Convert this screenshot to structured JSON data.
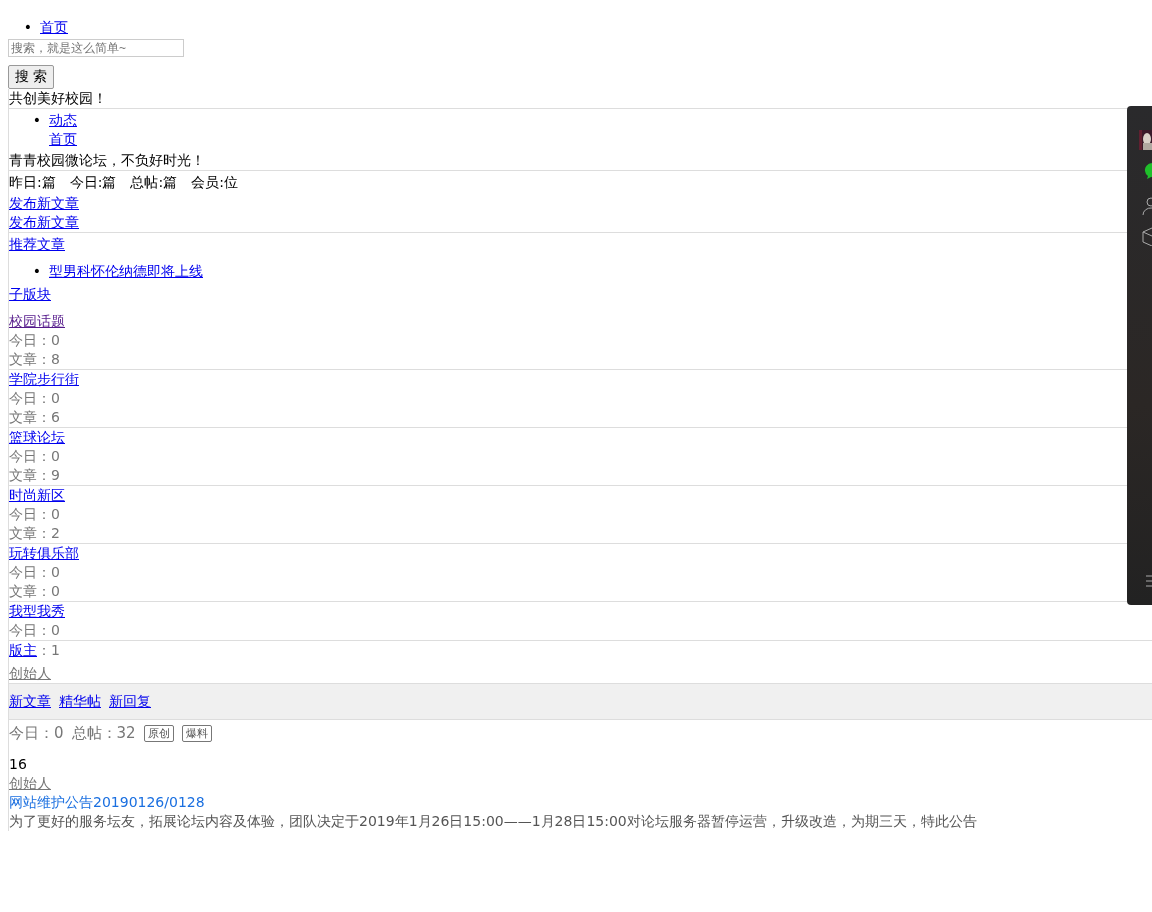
{
  "top_nav": [
    {
      "marker": "•",
      "label": "首页"
    }
  ],
  "search": {
    "placeholder": "搜索，就是这么简单~",
    "button": "搜 索"
  },
  "slogan": "共创美好校园！",
  "sub_nav": [
    {
      "marker": "•",
      "label": "动态"
    },
    {
      "label": "首页"
    }
  ],
  "tagline": "青青校园微论坛，不负好时光！",
  "stats": [
    "昨日:篇",
    "今日:篇",
    "总帖:篇",
    "会员:位"
  ],
  "post_links": [
    "发布新文章",
    "发布新文章"
  ],
  "recommended": {
    "title": "推荐文章",
    "items": [
      {
        "marker": "•",
        "label": "型男科怀伦纳德即将上线"
      }
    ]
  },
  "subforums": {
    "title": "子版块",
    "items": [
      {
        "name": "校园话题",
        "today": "今日：0",
        "posts": "文章：8"
      },
      {
        "name": "学院步行街",
        "today": "今日：0",
        "posts": "文章：6"
      },
      {
        "name": "篮球论坛",
        "today": "今日：0",
        "posts": "文章：9"
      },
      {
        "name": "时尚新区",
        "today": "今日：0",
        "posts": "文章：2"
      },
      {
        "name": "玩转俱乐部",
        "today": "今日：0",
        "posts": "文章：0"
      },
      {
        "name": "我型我秀",
        "today": "今日：0"
      }
    ]
  },
  "moderators": {
    "label": "版主",
    "count": "：1",
    "role": "创始人"
  },
  "filters": [
    "新文章",
    "精华帖",
    "新回复"
  ],
  "summary": {
    "today": "今日：0",
    "total": "总帖：32",
    "tags": [
      "原创",
      "爆料"
    ]
  },
  "post": {
    "count": "16",
    "author": "创始人",
    "title": "网站维护公告20190126/0128",
    "excerpt": "为了更好的服务坛友，拓展论坛内容及体验，团队决定于2019年1月26日15:00——1月28日15:00对论坛服务器暂停运营，升级改造，为期三天，特此公告"
  }
}
